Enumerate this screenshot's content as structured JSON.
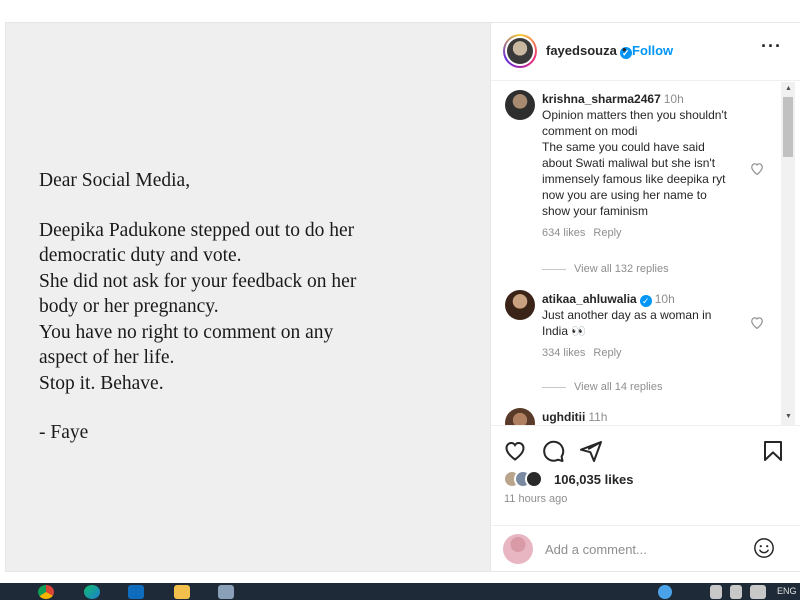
{
  "post": {
    "lines": [
      "Dear Social Media,",
      "Deepika Padukone stepped out to do her",
      "democratic duty and vote.",
      "She did not ask for your feedback on her",
      "body or her pregnancy.",
      "You have no right to comment on any",
      "aspect of her life.",
      "Stop it. Behave.",
      "- Faye"
    ]
  },
  "header": {
    "username": "fayedsouza",
    "verified_mark": "✓",
    "separator": "•",
    "follow_label": "Follow",
    "more_label": "···"
  },
  "comments": [
    {
      "username": "krishna_sharma2467",
      "time": "10h",
      "text_lines": [
        "Opinion matters then you shouldn't",
        "comment on modi",
        "The same you could have said",
        "about Swati maliwal but she isn't",
        "immensely famous like deepika ryt",
        "now you are using her name to",
        "show your faminism"
      ],
      "likes": "634 likes",
      "reply_label": "Reply",
      "view_replies": "View all 132 replies"
    },
    {
      "username": "atikaa_ahluwalia",
      "verified_mark": "✓",
      "time": "10h",
      "text_lines": [
        "Just another day as a woman in",
        "India 👀"
      ],
      "likes": "334 likes",
      "reply_label": "Reply",
      "view_replies": "View all 14 replies"
    },
    {
      "username": "ughditii",
      "time": "11h"
    }
  ],
  "actions": {
    "likes_count": "106,035 likes",
    "time_ago": "11 hours ago"
  },
  "add_comment": {
    "placeholder": "Add a comment..."
  },
  "taskbar": {
    "right_text": "ENG"
  },
  "colors": {
    "link_blue": "#0095f6",
    "secondary_text": "#8e8e8e",
    "post_background": "#efefef"
  },
  "icons": [
    "heart-icon",
    "comment-icon",
    "share-icon",
    "bookmark-icon",
    "emoji-icon",
    "more-icon",
    "verified-icon"
  ]
}
